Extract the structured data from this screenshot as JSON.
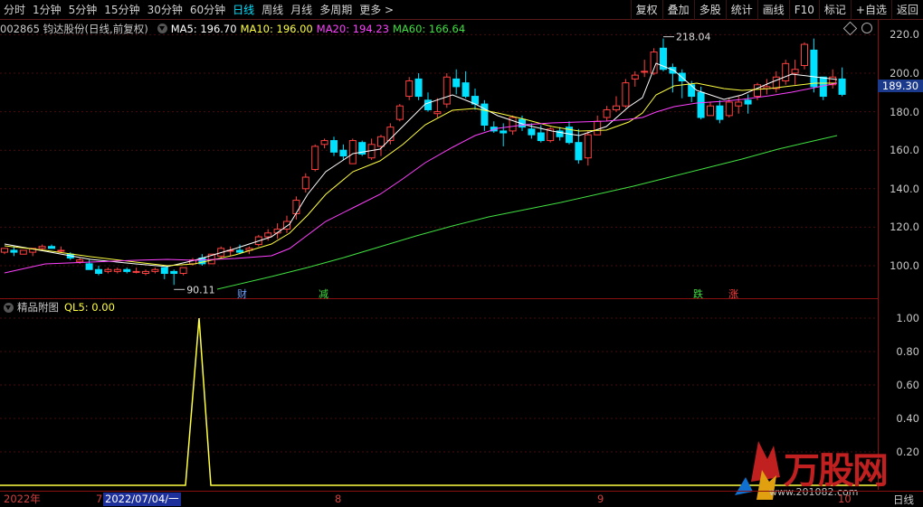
{
  "toolbar": {
    "tabs": [
      "分时",
      "1分钟",
      "5分钟",
      "15分钟",
      "30分钟",
      "60分钟",
      "日线",
      "周线",
      "月线",
      "多周期",
      "更多 >"
    ],
    "active_tab": "日线",
    "tools": [
      "复权",
      "叠加",
      "多股",
      "统计",
      "画线",
      "F10",
      "标记",
      "+自选",
      "返回"
    ]
  },
  "main": {
    "stock_label": "002865 钧达股份(日线,前复权)",
    "ma5": "MA5: 196.70",
    "ma10": "MA10: 196.00",
    "ma20": "MA20: 194.23",
    "ma60": "MA60: 166.64",
    "current_price": "189.30",
    "high_label": "218.04",
    "low_label": "90.11",
    "price_axis": [
      "220.0",
      "200.0",
      "180.0",
      "160.0",
      "140.0",
      "120.0",
      "100.0"
    ]
  },
  "markers": [
    {
      "text": "财",
      "color": "#6aa0ff"
    },
    {
      "text": "减",
      "color": "#40e040"
    },
    {
      "text": "跌",
      "color": "#40e040"
    },
    {
      "text": "涨",
      "color": "#ff4040"
    }
  ],
  "sub": {
    "title": "精品附图",
    "ql5": "QL5: 0.00",
    "axis": [
      "1.00",
      "0.80",
      "0.60",
      "0.40",
      "0.20"
    ]
  },
  "bottom": {
    "year": "2022年",
    "m7": "7",
    "selected_date": "2022/07/04/一",
    "m8": "8",
    "m9": "9",
    "m10": "10",
    "period": "日线"
  },
  "watermark": {
    "brand": "万股网",
    "url": "www.201082.com"
  },
  "colors": {
    "up": "#ff4040",
    "down": "#00e0ff",
    "ma5": "#ffffff",
    "ma10": "#ffff40",
    "ma20": "#ff40ff",
    "ma60": "#40e040",
    "ql5": "#ffff40"
  },
  "candles": [
    [
      107,
      109,
      106,
      109
    ],
    [
      108,
      110,
      105,
      107
    ],
    [
      106,
      108,
      106,
      108
    ],
    [
      107,
      109,
      105,
      109
    ],
    [
      109,
      111,
      108,
      110
    ],
    [
      110,
      111,
      109,
      109
    ],
    [
      108,
      110,
      107,
      108
    ],
    [
      106,
      107,
      103,
      104
    ],
    [
      102,
      104,
      101,
      103
    ],
    [
      101,
      103,
      98,
      98
    ],
    [
      98,
      100,
      95,
      96
    ],
    [
      97,
      99,
      96,
      98
    ],
    [
      97,
      99,
      96,
      98
    ],
    [
      98,
      99,
      96,
      97
    ],
    [
      97,
      99,
      96,
      97
    ],
    [
      96,
      98,
      95,
      97
    ],
    [
      97,
      99,
      96,
      98
    ],
    [
      99,
      99,
      93,
      96
    ],
    [
      97,
      98,
      90,
      96
    ],
    [
      96,
      99,
      95,
      99
    ],
    [
      101,
      104,
      100,
      103
    ],
    [
      104,
      106,
      100,
      101
    ],
    [
      101,
      106,
      101,
      106
    ],
    [
      105,
      110,
      104,
      109
    ],
    [
      108,
      110,
      105,
      108
    ],
    [
      108,
      111,
      106,
      107
    ],
    [
      108,
      110,
      106,
      109
    ],
    [
      111,
      116,
      110,
      115
    ],
    [
      115,
      119,
      113,
      117
    ],
    [
      117,
      122,
      114,
      119
    ],
    [
      119,
      126,
      117,
      123
    ],
    [
      127,
      136,
      124,
      134
    ],
    [
      140,
      148,
      138,
      146
    ],
    [
      150,
      163,
      149,
      162
    ],
    [
      163,
      166,
      161,
      165
    ],
    [
      165,
      167,
      157,
      159
    ],
    [
      160,
      163,
      155,
      157
    ],
    [
      153,
      166,
      153,
      165
    ],
    [
      164,
      165,
      157,
      158
    ],
    [
      156,
      166,
      155,
      163
    ],
    [
      162,
      168,
      157,
      167
    ],
    [
      165,
      174,
      163,
      172
    ],
    [
      176,
      184,
      175,
      183
    ],
    [
      188,
      198,
      186,
      196
    ],
    [
      197,
      200,
      186,
      188
    ],
    [
      186,
      190,
      180,
      181
    ],
    [
      179,
      187,
      177,
      180
    ],
    [
      184,
      200,
      182,
      198
    ],
    [
      197,
      202,
      189,
      193
    ],
    [
      195,
      201,
      187,
      188
    ],
    [
      188,
      192,
      181,
      184
    ],
    [
      184,
      186,
      170,
      173
    ],
    [
      172,
      175,
      169,
      170
    ],
    [
      170,
      174,
      162,
      169
    ],
    [
      170,
      178,
      168,
      177
    ],
    [
      176,
      178,
      170,
      172
    ],
    [
      171,
      174,
      166,
      168
    ],
    [
      169,
      173,
      164,
      165
    ],
    [
      165,
      172,
      164,
      171
    ],
    [
      170,
      172,
      165,
      167
    ],
    [
      172,
      175,
      163,
      164
    ],
    [
      164,
      171,
      153,
      155
    ],
    [
      156,
      170,
      152,
      168
    ],
    [
      168,
      178,
      168,
      175
    ],
    [
      177,
      183,
      175,
      181
    ],
    [
      181,
      188,
      180,
      183
    ],
    [
      183,
      197,
      182,
      195
    ],
    [
      197,
      201,
      193,
      199
    ],
    [
      201,
      207,
      198,
      201
    ],
    [
      200,
      213,
      199,
      211
    ],
    [
      213,
      218,
      201,
      202
    ],
    [
      203,
      205,
      190,
      200
    ],
    [
      200,
      202,
      187,
      196
    ],
    [
      194,
      196,
      185,
      188
    ],
    [
      190,
      193,
      176,
      177
    ],
    [
      178,
      185,
      178,
      183
    ],
    [
      183,
      186,
      174,
      176
    ],
    [
      178,
      187,
      177,
      185
    ],
    [
      183,
      188,
      179,
      185
    ],
    [
      186,
      189,
      179,
      184
    ],
    [
      188,
      195,
      186,
      194
    ],
    [
      192,
      197,
      189,
      193
    ],
    [
      192,
      201,
      190,
      198
    ],
    [
      196,
      207,
      194,
      205
    ],
    [
      200,
      207,
      194,
      202
    ],
    [
      204,
      216,
      202,
      215
    ],
    [
      212,
      218,
      190,
      193
    ],
    [
      198,
      198,
      186,
      188
    ],
    [
      194,
      202,
      192,
      198
    ],
    [
      197,
      203,
      188,
      189
    ]
  ],
  "ma_lines": {
    "ma5": [
      [
        5,
        270
      ],
      [
        50,
        278
      ],
      [
        100,
        287
      ],
      [
        150,
        292
      ],
      [
        185,
        295
      ],
      [
        215,
        288
      ],
      [
        260,
        275
      ],
      [
        300,
        262
      ],
      [
        320,
        248
      ],
      [
        340,
        215
      ],
      [
        360,
        190
      ],
      [
        390,
        170
      ],
      [
        420,
        165
      ],
      [
        445,
        140
      ],
      [
        470,
        115
      ],
      [
        500,
        105
      ],
      [
        525,
        115
      ],
      [
        550,
        128
      ],
      [
        580,
        138
      ],
      [
        610,
        145
      ],
      [
        640,
        150
      ],
      [
        670,
        140
      ],
      [
        695,
        118
      ],
      [
        710,
        108
      ],
      [
        725,
        70
      ],
      [
        745,
        78
      ],
      [
        770,
        100
      ],
      [
        800,
        110
      ],
      [
        820,
        105
      ],
      [
        850,
        92
      ],
      [
        875,
        82
      ],
      [
        900,
        85
      ],
      [
        925,
        88
      ]
    ],
    "ma10": [
      [
        5,
        272
      ],
      [
        50,
        277
      ],
      [
        100,
        284
      ],
      [
        150,
        290
      ],
      [
        185,
        294
      ],
      [
        215,
        292
      ],
      [
        260,
        282
      ],
      [
        300,
        270
      ],
      [
        320,
        258
      ],
      [
        340,
        238
      ],
      [
        360,
        215
      ],
      [
        390,
        190
      ],
      [
        420,
        178
      ],
      [
        445,
        160
      ],
      [
        470,
        138
      ],
      [
        500,
        122
      ],
      [
        525,
        120
      ],
      [
        550,
        125
      ],
      [
        580,
        132
      ],
      [
        610,
        140
      ],
      [
        640,
        145
      ],
      [
        670,
        144
      ],
      [
        695,
        135
      ],
      [
        710,
        125
      ],
      [
        725,
        105
      ],
      [
        745,
        95
      ],
      [
        770,
        92
      ],
      [
        800,
        98
      ],
      [
        820,
        100
      ],
      [
        850,
        98
      ],
      [
        875,
        95
      ],
      [
        900,
        92
      ],
      [
        925,
        92
      ]
    ],
    "ma20": [
      [
        5,
        302
      ],
      [
        50,
        292
      ],
      [
        100,
        290
      ],
      [
        150,
        288
      ],
      [
        185,
        287
      ],
      [
        215,
        288
      ],
      [
        260,
        286
      ],
      [
        300,
        283
      ],
      [
        320,
        275
      ],
      [
        340,
        260
      ],
      [
        360,
        245
      ],
      [
        390,
        230
      ],
      [
        420,
        215
      ],
      [
        445,
        198
      ],
      [
        470,
        180
      ],
      [
        500,
        163
      ],
      [
        525,
        150
      ],
      [
        550,
        142
      ],
      [
        580,
        138
      ],
      [
        610,
        136
      ],
      [
        640,
        135
      ],
      [
        670,
        134
      ],
      [
        695,
        132
      ],
      [
        710,
        130
      ],
      [
        725,
        124
      ],
      [
        745,
        118
      ],
      [
        770,
        114
      ],
      [
        800,
        112
      ],
      [
        820,
        110
      ],
      [
        850,
        106
      ],
      [
        875,
        102
      ],
      [
        900,
        97
      ],
      [
        925,
        92
      ]
    ],
    "ma60": [
      [
        240,
        320
      ],
      [
        300,
        306
      ],
      [
        340,
        296
      ],
      [
        380,
        285
      ],
      [
        420,
        273
      ],
      [
        460,
        261
      ],
      [
        500,
        250
      ],
      [
        540,
        240
      ],
      [
        580,
        232
      ],
      [
        620,
        224
      ],
      [
        660,
        215
      ],
      [
        700,
        206
      ],
      [
        740,
        196
      ],
      [
        780,
        186
      ],
      [
        820,
        176
      ],
      [
        860,
        165
      ],
      [
        890,
        158
      ],
      [
        925,
        150
      ]
    ]
  },
  "ql5_series": [
    [
      0,
      537
    ],
    [
      205,
      537
    ],
    [
      220,
      352
    ],
    [
      233,
      537
    ],
    [
      970,
      537
    ]
  ]
}
